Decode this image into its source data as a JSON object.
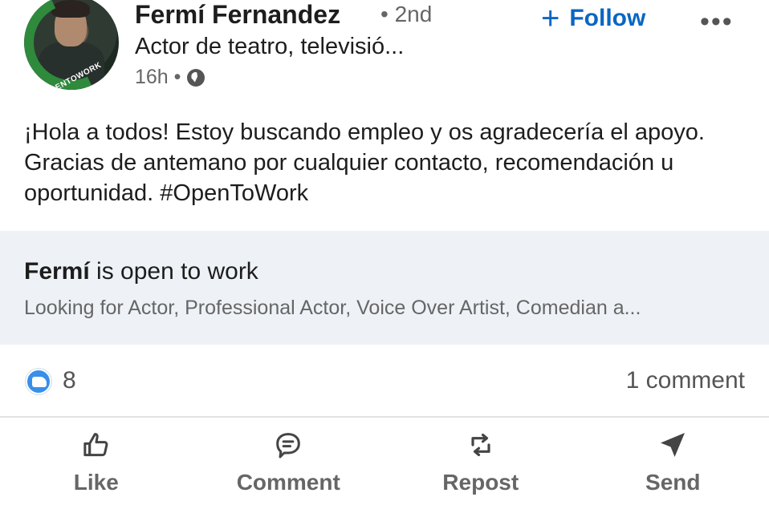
{
  "author": {
    "name": "Fermí Fernandez",
    "degree": "• 2nd",
    "headline": "Actor de teatro, televisió...",
    "time": "16h •",
    "avatar_badge": "#OPENTOWORK"
  },
  "follow": {
    "label": "Follow",
    "plus": "+"
  },
  "more_label": "•••",
  "post": {
    "text": "¡Hola a todos! Estoy buscando empleo y os agradecería el apoyo. Gracias de antemano por cualquier contacto, recomendación u oportunidad. #OpenToWork"
  },
  "open_to_work": {
    "name": "Fermí",
    "title_rest": " is open to work",
    "looking_for": "Looking for Actor, Professional Actor, Voice Over Artist, Comedian a..."
  },
  "social": {
    "like_count": "8",
    "comment_count": "1 comment"
  },
  "actions": [
    {
      "label": "Like",
      "icon": "thumbs-up-icon"
    },
    {
      "label": "Comment",
      "icon": "comment-icon"
    },
    {
      "label": "Repost",
      "icon": "repost-icon"
    },
    {
      "label": "Send",
      "icon": "send-icon"
    }
  ],
  "colors": {
    "accent": "#0a66c2",
    "like_blue": "#378fe9",
    "panel_bg": "#eef2f6",
    "avatar_ring": "#2f8a3c"
  }
}
